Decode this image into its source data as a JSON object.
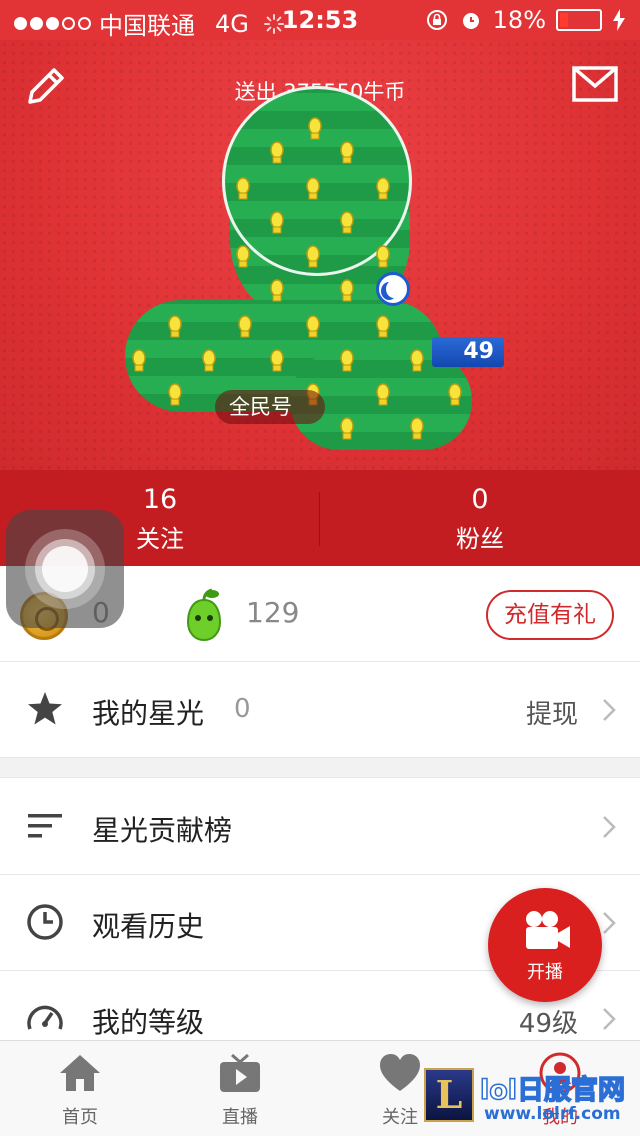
{
  "status_bar": {
    "carrier": "中国联通",
    "network": "4G",
    "time": "12:53",
    "battery": "18%"
  },
  "header": {
    "sent_text": "送出 375550牛币",
    "level_badge": "49",
    "name_pill": "全民号",
    "colors": {
      "background": "#e23336",
      "stats_band": "#c41d21"
    }
  },
  "stats": {
    "following": {
      "count": "16",
      "label": "关注"
    },
    "fans": {
      "count": "0",
      "label": "粉丝"
    }
  },
  "wallet": {
    "coins": "0",
    "pears": "129",
    "recharge_label": "充值有礼"
  },
  "menu": {
    "starlight": {
      "label": "我的星光",
      "value": "0",
      "action": "提现",
      "icon": "star-icon"
    },
    "ranking": {
      "label": "星光贡献榜",
      "icon": "list-icon"
    },
    "history": {
      "label": "观看历史",
      "icon": "clock-icon"
    },
    "level": {
      "label": "我的等级",
      "value": "49级",
      "icon": "gauge-icon"
    }
  },
  "fab": {
    "label": "开播",
    "icon": "camera-icon"
  },
  "tabbar": {
    "tabs": [
      {
        "label": "首页",
        "icon": "home-icon"
      },
      {
        "label": "直播",
        "icon": "tv-icon"
      },
      {
        "label": "关注",
        "icon": "heart-icon"
      },
      {
        "label": "我的",
        "icon": "profile-icon"
      }
    ]
  },
  "watermark": {
    "logo_letter": "L",
    "title": "lol日服官网",
    "url": "www.lolrf.com"
  }
}
